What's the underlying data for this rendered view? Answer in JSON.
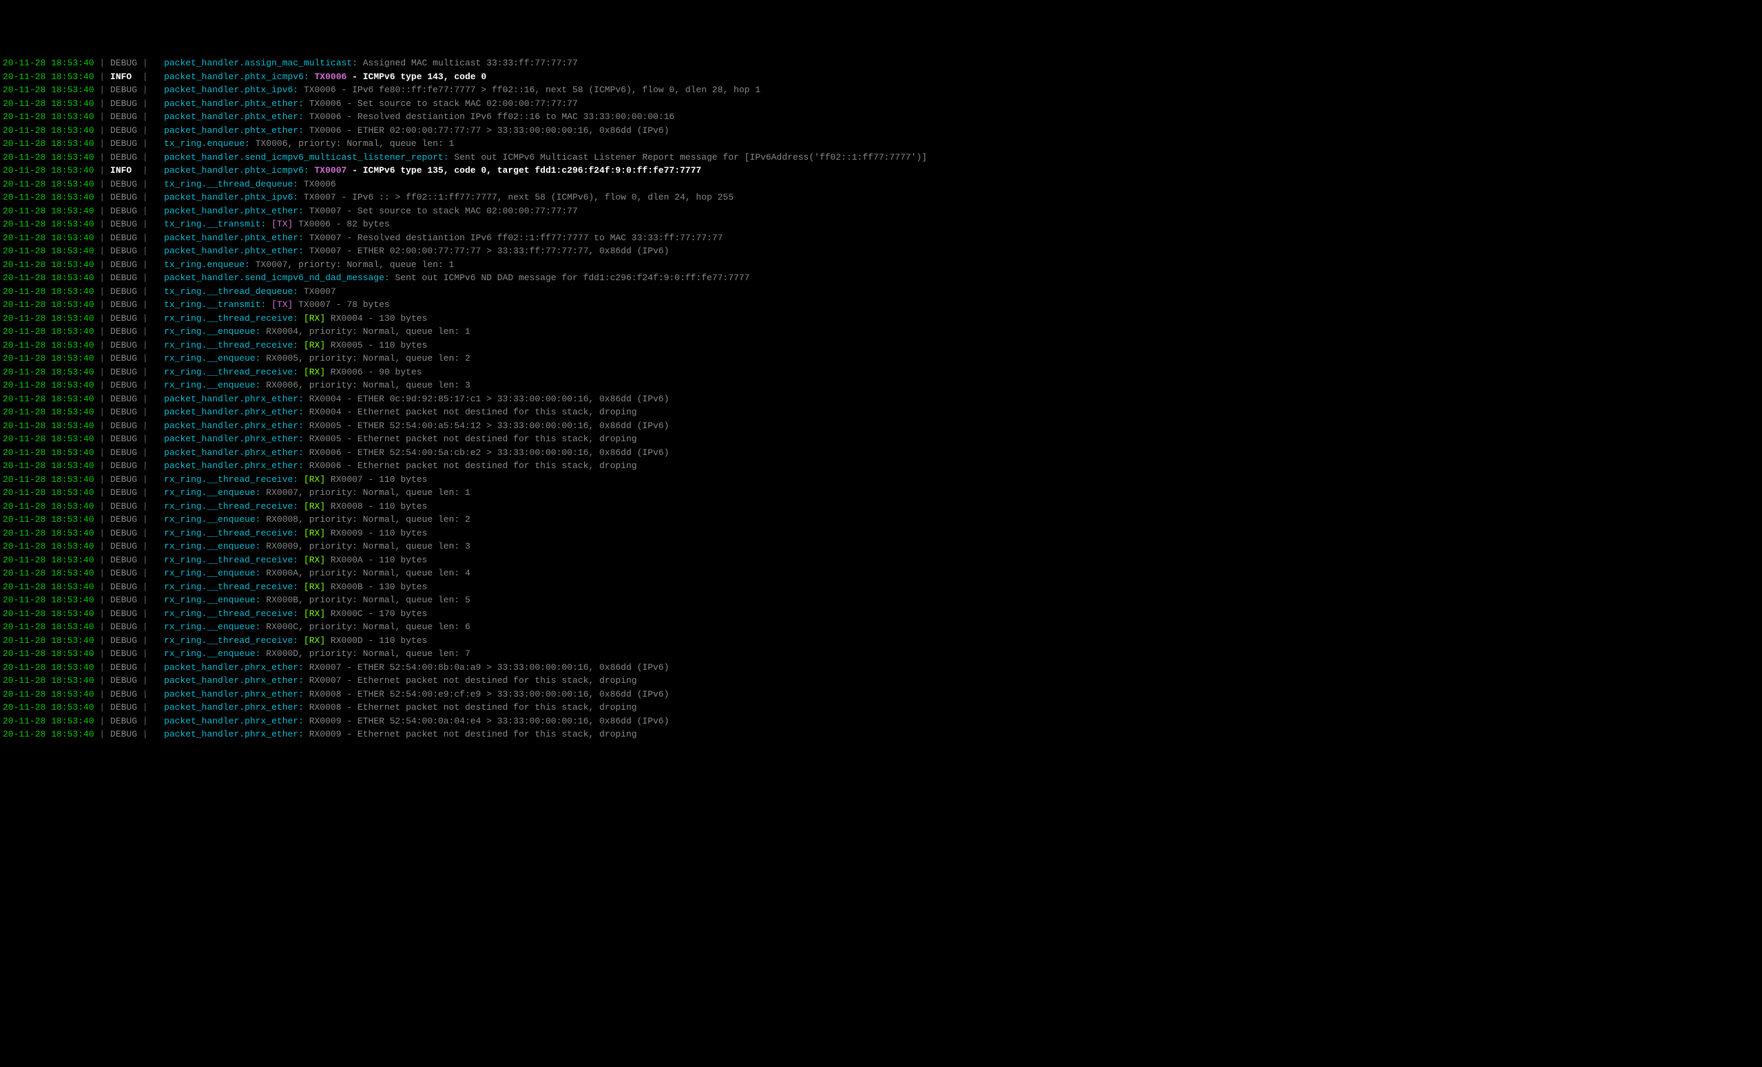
{
  "timestamp": "20-11-28 18:53:40",
  "sep": " | ",
  "levels": {
    "debug": "DEBUG",
    "info": "INFO "
  },
  "lines": [
    {
      "lvl": "debug",
      "mod": "packet_handler.assign_mac_multicast:",
      "txm": "",
      "tx": "",
      "tag": "",
      "msg": " Assigned MAC multicast 33:33:ff:77:77:77",
      "bold": false
    },
    {
      "lvl": "info",
      "mod": "packet_handler.phtx_icmpv6:",
      "txm": " TX0006",
      "tx": "",
      "tag": "",
      "msg": " - ICMPv6 type 143, code 0",
      "bold": true
    },
    {
      "lvl": "debug",
      "mod": "packet_handler.phtx_ipv6:",
      "txm": "",
      "tx": " TX0006",
      "tag": "",
      "msg": " - IPv6 fe80::ff:fe77:7777 > ff02::16, next 58 (ICMPv6), flow 0, dlen 28, hop 1",
      "bold": false
    },
    {
      "lvl": "debug",
      "mod": "packet_handler.phtx_ether:",
      "txm": "",
      "tx": " TX0006",
      "tag": "",
      "msg": " - Set source to stack MAC 02:00:00:77:77:77",
      "bold": false
    },
    {
      "lvl": "debug",
      "mod": "packet_handler.phtx_ether:",
      "txm": "",
      "tx": " TX0006",
      "tag": "",
      "msg": " - Resolved destiantion IPv6 ff02::16 to MAC 33:33:00:00:00:16",
      "bold": false
    },
    {
      "lvl": "debug",
      "mod": "packet_handler.phtx_ether:",
      "txm": "",
      "tx": " TX0006",
      "tag": "",
      "msg": " - ETHER 02:00:00:77:77:77 > 33:33:00:00:00:16, 0x86dd (IPv6)",
      "bold": false
    },
    {
      "lvl": "debug",
      "mod": "tx_ring.enqueue:",
      "txm": "",
      "tx": " TX0006",
      "tag": "",
      "msg": ", priorty: Normal, queue len: 1",
      "bold": false
    },
    {
      "lvl": "debug",
      "mod": "packet_handler.send_icmpv6_multicast_listener_report:",
      "txm": "",
      "tx": "",
      "tag": "",
      "msg": " Sent out ICMPv6 Multicast Listener Report message for [IPv6Address('ff02::1:ff77:7777')]",
      "bold": false
    },
    {
      "lvl": "info",
      "mod": "packet_handler.phtx_icmpv6:",
      "txm": " TX0007",
      "tx": "",
      "tag": "",
      "msg": " - ICMPv6 type 135, code 0, target fdd1:c296:f24f:9:0:ff:fe77:7777",
      "bold": true
    },
    {
      "lvl": "debug",
      "mod": "tx_ring.__thread_dequeue:",
      "txm": "",
      "tx": " TX0006",
      "tag": "",
      "msg": "",
      "bold": false
    },
    {
      "lvl": "debug",
      "mod": "packet_handler.phtx_ipv6:",
      "txm": "",
      "tx": " TX0007",
      "tag": "",
      "msg": " - IPv6 :: > ff02::1:ff77:7777, next 58 (ICMPv6), flow 0, dlen 24, hop 255",
      "bold": false
    },
    {
      "lvl": "debug",
      "mod": "packet_handler.phtx_ether:",
      "txm": "",
      "tx": " TX0007",
      "tag": "",
      "msg": " - Set source to stack MAC 02:00:00:77:77:77",
      "bold": false
    },
    {
      "lvl": "debug",
      "mod": "tx_ring.__transmit:",
      "txm": "",
      "tx": "",
      "tag": " [TX]",
      "tagc": "txtag",
      "msg": " TX0006 - 82 bytes",
      "bold": false
    },
    {
      "lvl": "debug",
      "mod": "packet_handler.phtx_ether:",
      "txm": "",
      "tx": " TX0007",
      "tag": "",
      "msg": " - Resolved destiantion IPv6 ff02::1:ff77:7777 to MAC 33:33:ff:77:77:77",
      "bold": false
    },
    {
      "lvl": "debug",
      "mod": "packet_handler.phtx_ether:",
      "txm": "",
      "tx": " TX0007",
      "tag": "",
      "msg": " - ETHER 02:00:00:77:77:77 > 33:33:ff:77:77:77, 0x86dd (IPv6)",
      "bold": false
    },
    {
      "lvl": "debug",
      "mod": "tx_ring.enqueue:",
      "txm": "",
      "tx": " TX0007",
      "tag": "",
      "msg": ", priorty: Normal, queue len: 1",
      "bold": false
    },
    {
      "lvl": "debug",
      "mod": "packet_handler.send_icmpv6_nd_dad_message:",
      "txm": "",
      "tx": "",
      "tag": "",
      "msg": " Sent out ICMPv6 ND DAD message for fdd1:c296:f24f:9:0:ff:fe77:7777",
      "bold": false
    },
    {
      "lvl": "debug",
      "mod": "tx_ring.__thread_dequeue:",
      "txm": "",
      "tx": " TX0007",
      "tag": "",
      "msg": "",
      "bold": false
    },
    {
      "lvl": "debug",
      "mod": "tx_ring.__transmit:",
      "txm": "",
      "tx": "",
      "tag": " [TX]",
      "tagc": "txtag",
      "msg": " TX0007 - 78 bytes",
      "bold": false
    },
    {
      "lvl": "debug",
      "mod": "rx_ring.__thread_receive:",
      "txm": "",
      "tx": "",
      "tag": " [RX]",
      "tagc": "rxtag",
      "msg": " RX0004 - 130 bytes",
      "bold": false
    },
    {
      "lvl": "debug",
      "mod": "rx_ring.__enqueue:",
      "txm": "",
      "tx": "",
      "tag": "",
      "msg": " RX0004, priority: Normal, queue len: 1",
      "bold": false
    },
    {
      "lvl": "debug",
      "mod": "rx_ring.__thread_receive:",
      "txm": "",
      "tx": "",
      "tag": " [RX]",
      "tagc": "rxtag",
      "msg": " RX0005 - 110 bytes",
      "bold": false
    },
    {
      "lvl": "debug",
      "mod": "rx_ring.__enqueue:",
      "txm": "",
      "tx": "",
      "tag": "",
      "msg": " RX0005, priority: Normal, queue len: 2",
      "bold": false
    },
    {
      "lvl": "debug",
      "mod": "rx_ring.__thread_receive:",
      "txm": "",
      "tx": "",
      "tag": " [RX]",
      "tagc": "rxtag",
      "msg": " RX0006 - 90 bytes",
      "bold": false
    },
    {
      "lvl": "debug",
      "mod": "rx_ring.__enqueue:",
      "txm": "",
      "tx": "",
      "tag": "",
      "msg": " RX0006, priority: Normal, queue len: 3",
      "bold": false
    },
    {
      "lvl": "debug",
      "mod": "packet_handler.phrx_ether:",
      "txm": "",
      "tx": "",
      "tag": "",
      "msg": " RX0004 - ETHER 0c:9d:92:85:17:c1 > 33:33:00:00:00:16, 0x86dd (IPv6)",
      "bold": false
    },
    {
      "lvl": "debug",
      "mod": "packet_handler.phrx_ether:",
      "txm": "",
      "tx": "",
      "tag": "",
      "msg": " RX0004 - Ethernet packet not destined for this stack, droping",
      "bold": false
    },
    {
      "lvl": "debug",
      "mod": "packet_handler.phrx_ether:",
      "txm": "",
      "tx": "",
      "tag": "",
      "msg": " RX0005 - ETHER 52:54:00:a5:54:12 > 33:33:00:00:00:16, 0x86dd (IPv6)",
      "bold": false
    },
    {
      "lvl": "debug",
      "mod": "packet_handler.phrx_ether:",
      "txm": "",
      "tx": "",
      "tag": "",
      "msg": " RX0005 - Ethernet packet not destined for this stack, droping",
      "bold": false
    },
    {
      "lvl": "debug",
      "mod": "packet_handler.phrx_ether:",
      "txm": "",
      "tx": "",
      "tag": "",
      "msg": " RX0006 - ETHER 52:54:00:5a:cb:e2 > 33:33:00:00:00:16, 0x86dd (IPv6)",
      "bold": false
    },
    {
      "lvl": "debug",
      "mod": "packet_handler.phrx_ether:",
      "txm": "",
      "tx": "",
      "tag": "",
      "msg": " RX0006 - Ethernet packet not destined for this stack, droping",
      "bold": false
    },
    {
      "lvl": "debug",
      "mod": "rx_ring.__thread_receive:",
      "txm": "",
      "tx": "",
      "tag": " [RX]",
      "tagc": "rxtag",
      "msg": " RX0007 - 110 bytes",
      "bold": false
    },
    {
      "lvl": "debug",
      "mod": "rx_ring.__enqueue:",
      "txm": "",
      "tx": "",
      "tag": "",
      "msg": " RX0007, priority: Normal, queue len: 1",
      "bold": false
    },
    {
      "lvl": "debug",
      "mod": "rx_ring.__thread_receive:",
      "txm": "",
      "tx": "",
      "tag": " [RX]",
      "tagc": "rxtag",
      "msg": " RX0008 - 110 bytes",
      "bold": false
    },
    {
      "lvl": "debug",
      "mod": "rx_ring.__enqueue:",
      "txm": "",
      "tx": "",
      "tag": "",
      "msg": " RX0008, priority: Normal, queue len: 2",
      "bold": false
    },
    {
      "lvl": "debug",
      "mod": "rx_ring.__thread_receive:",
      "txm": "",
      "tx": "",
      "tag": " [RX]",
      "tagc": "rxtag",
      "msg": " RX0009 - 110 bytes",
      "bold": false
    },
    {
      "lvl": "debug",
      "mod": "rx_ring.__enqueue:",
      "txm": "",
      "tx": "",
      "tag": "",
      "msg": " RX0009, priority: Normal, queue len: 3",
      "bold": false
    },
    {
      "lvl": "debug",
      "mod": "rx_ring.__thread_receive:",
      "txm": "",
      "tx": "",
      "tag": " [RX]",
      "tagc": "rxtag",
      "msg": " RX000A - 110 bytes",
      "bold": false
    },
    {
      "lvl": "debug",
      "mod": "rx_ring.__enqueue:",
      "txm": "",
      "tx": "",
      "tag": "",
      "msg": " RX000A, priority: Normal, queue len: 4",
      "bold": false
    },
    {
      "lvl": "debug",
      "mod": "rx_ring.__thread_receive:",
      "txm": "",
      "tx": "",
      "tag": " [RX]",
      "tagc": "rxtag",
      "msg": " RX000B - 130 bytes",
      "bold": false
    },
    {
      "lvl": "debug",
      "mod": "rx_ring.__enqueue:",
      "txm": "",
      "tx": "",
      "tag": "",
      "msg": " RX000B, priority: Normal, queue len: 5",
      "bold": false
    },
    {
      "lvl": "debug",
      "mod": "rx_ring.__thread_receive:",
      "txm": "",
      "tx": "",
      "tag": " [RX]",
      "tagc": "rxtag",
      "msg": " RX000C - 170 bytes",
      "bold": false
    },
    {
      "lvl": "debug",
      "mod": "rx_ring.__enqueue:",
      "txm": "",
      "tx": "",
      "tag": "",
      "msg": " RX000C, priority: Normal, queue len: 6",
      "bold": false
    },
    {
      "lvl": "debug",
      "mod": "rx_ring.__thread_receive:",
      "txm": "",
      "tx": "",
      "tag": " [RX]",
      "tagc": "rxtag",
      "msg": " RX000D - 110 bytes",
      "bold": false
    },
    {
      "lvl": "debug",
      "mod": "rx_ring.__enqueue:",
      "txm": "",
      "tx": "",
      "tag": "",
      "msg": " RX000D, priority: Normal, queue len: 7",
      "bold": false
    },
    {
      "lvl": "debug",
      "mod": "packet_handler.phrx_ether:",
      "txm": "",
      "tx": "",
      "tag": "",
      "msg": " RX0007 - ETHER 52:54:00:8b:0a:a9 > 33:33:00:00:00:16, 0x86dd (IPv6)",
      "bold": false
    },
    {
      "lvl": "debug",
      "mod": "packet_handler.phrx_ether:",
      "txm": "",
      "tx": "",
      "tag": "",
      "msg": " RX0007 - Ethernet packet not destined for this stack, droping",
      "bold": false
    },
    {
      "lvl": "debug",
      "mod": "packet_handler.phrx_ether:",
      "txm": "",
      "tx": "",
      "tag": "",
      "msg": " RX0008 - ETHER 52:54:00:e9:cf:e9 > 33:33:00:00:00:16, 0x86dd (IPv6)",
      "bold": false
    },
    {
      "lvl": "debug",
      "mod": "packet_handler.phrx_ether:",
      "txm": "",
      "tx": "",
      "tag": "",
      "msg": " RX0008 - Ethernet packet not destined for this stack, droping",
      "bold": false
    },
    {
      "lvl": "debug",
      "mod": "packet_handler.phrx_ether:",
      "txm": "",
      "tx": "",
      "tag": "",
      "msg": " RX0009 - ETHER 52:54:00:0a:04:e4 > 33:33:00:00:00:16, 0x86dd (IPv6)",
      "bold": false
    },
    {
      "lvl": "debug",
      "mod": "packet_handler.phrx_ether:",
      "txm": "",
      "tx": "",
      "tag": "",
      "msg": " RX0009 - Ethernet packet not destined for this stack, droping",
      "bold": false
    }
  ]
}
